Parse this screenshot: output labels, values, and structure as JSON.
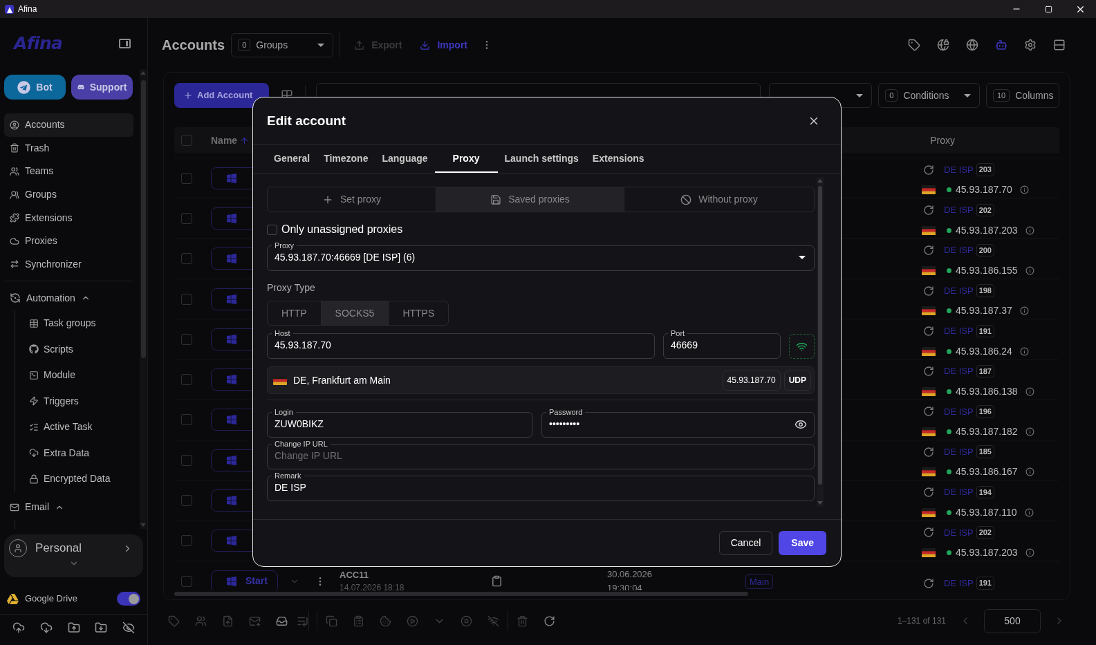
{
  "window": {
    "title": "Afina"
  },
  "sidebar": {
    "logo": "Afina",
    "buttons": [
      {
        "label": "Bot"
      },
      {
        "label": "Support"
      }
    ],
    "nav": [
      {
        "label": "Accounts",
        "selected": true
      },
      {
        "label": "Trash",
        "selected": false
      },
      {
        "label": "Teams",
        "selected": false
      },
      {
        "label": "Groups",
        "selected": false
      },
      {
        "label": "Extensions",
        "selected": false
      },
      {
        "label": "Proxies",
        "selected": false
      },
      {
        "label": "Synchronizer",
        "selected": false
      }
    ],
    "sections": [
      {
        "label": "Automation",
        "expanded": true,
        "children": [
          {
            "label": "Task groups"
          },
          {
            "label": "Scripts"
          },
          {
            "label": "Module"
          },
          {
            "label": "Triggers"
          },
          {
            "label": "Active Task"
          },
          {
            "label": "Extra Data"
          },
          {
            "label": "Encrypted Data"
          }
        ]
      },
      {
        "label": "Email",
        "expanded": true
      }
    ],
    "workspace": {
      "label": "Personal"
    },
    "drive": {
      "label": "Google Drive",
      "on": true
    }
  },
  "header": {
    "title": "Accounts",
    "groups": {
      "count": "0",
      "label": "Groups"
    },
    "actions": [
      {
        "label": "Export",
        "disabled": true
      },
      {
        "label": "Import",
        "disabled": false
      }
    ]
  },
  "toolbar": {
    "add_button": "Add Account",
    "conditions": {
      "count": "0",
      "label": "Conditions"
    },
    "columns": {
      "count": "10",
      "label": "Columns"
    }
  },
  "table": {
    "all_checked": false,
    "columns": [
      {
        "label": "Name"
      },
      {
        "label": "Proxy"
      }
    ],
    "rows": [
      {
        "checked": false,
        "proxy": {
          "name": "DE ISP",
          "count": "203",
          "ip": "45.93.187.70"
        }
      },
      {
        "checked": false,
        "proxy": {
          "name": "DE ISP",
          "count": "202",
          "ip": "45.93.187.203"
        }
      },
      {
        "checked": false,
        "proxy": {
          "name": "DE ISP",
          "count": "200",
          "ip": "45.93.186.155"
        }
      },
      {
        "checked": false,
        "proxy": {
          "name": "DE ISP",
          "count": "198",
          "ip": "45.93.187.37"
        }
      },
      {
        "checked": false,
        "proxy": {
          "name": "DE ISP",
          "count": "191",
          "ip": "45.93.186.24"
        }
      },
      {
        "checked": false,
        "proxy": {
          "name": "DE ISP",
          "count": "187",
          "ip": "45.93.186.138"
        }
      },
      {
        "checked": false,
        "proxy": {
          "name": "DE ISP",
          "count": "196",
          "ip": "45.93.187.182"
        }
      },
      {
        "checked": false,
        "proxy": {
          "name": "DE ISP",
          "count": "185",
          "ip": "45.93.186.167"
        }
      },
      {
        "checked": false,
        "proxy": {
          "name": "DE ISP",
          "count": "194",
          "ip": "45.93.187.110"
        }
      },
      {
        "checked": false,
        "proxy": {
          "name": "DE ISP",
          "count": "202",
          "ip": "45.93.187.203"
        }
      },
      {
        "checked": false,
        "start": "Start",
        "name": "ACC11",
        "created": "14.07.2026 18:18",
        "date": "30.06.2026",
        "time": "19:30:04",
        "tag": "Main",
        "proxy": {
          "name": "DE ISP",
          "count": "191"
        }
      }
    ]
  },
  "pagination": {
    "range": "1–131 of 131",
    "per_page": "500"
  },
  "dialog": {
    "title": "Edit account",
    "tabs": [
      {
        "label": "General",
        "selected": false
      },
      {
        "label": "Timezone",
        "selected": false
      },
      {
        "label": "Language",
        "selected": false
      },
      {
        "label": "Proxy",
        "selected": true
      },
      {
        "label": "Launch settings",
        "selected": false
      },
      {
        "label": "Extensions",
        "selected": false
      }
    ],
    "modes": [
      {
        "label": "Set proxy",
        "selected": false
      },
      {
        "label": "Saved proxies",
        "selected": true
      },
      {
        "label": "Without proxy",
        "selected": false
      }
    ],
    "only_unassigned": {
      "label": "Only unassigned proxies",
      "checked": false
    },
    "proxy_select": {
      "label": "Proxy",
      "value": "45.93.187.70:46669 [DE ISP] (6)"
    },
    "proxy_type": {
      "label": "Proxy Type",
      "options": [
        {
          "label": "HTTP",
          "selected": false
        },
        {
          "label": "SOCKS5",
          "selected": true
        },
        {
          "label": "HTTPS",
          "selected": false
        }
      ]
    },
    "host": {
      "label": "Host",
      "value": "45.93.187.70"
    },
    "port": {
      "label": "Port",
      "value": "46669"
    },
    "location": {
      "text": "DE, Frankfurt am Main",
      "ip": "45.93.187.70",
      "protocol": "UDP"
    },
    "login": {
      "label": "Login",
      "value": "ZUW0BIKZ"
    },
    "password": {
      "label": "Password",
      "value": "•••••••••"
    },
    "change_ip_url": {
      "label": "Change IP URL",
      "placeholder": "Change IP URL"
    },
    "remark": {
      "label": "Remark",
      "value": "DE ISP"
    },
    "cancel": "Cancel",
    "save": "Save"
  }
}
